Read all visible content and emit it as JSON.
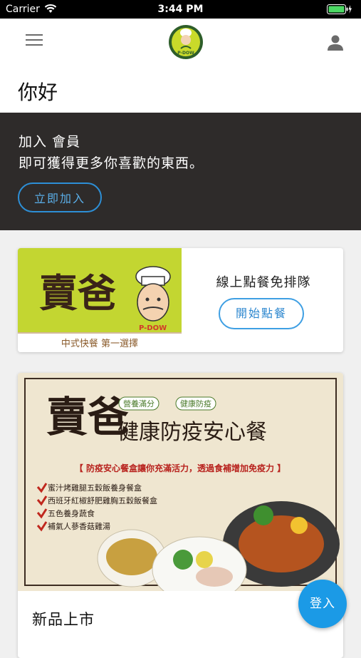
{
  "status_bar": {
    "carrier": "Carrier",
    "time": "3:44 PM"
  },
  "header": {
    "menu_icon": "hamburger-menu-icon",
    "logo_text": "P-DOW",
    "user_icon": "user-icon"
  },
  "greeting": "你好",
  "join_banner": {
    "line1": "加入 會員",
    "line2": "即可獲得更多你喜歡的東西。",
    "button_label": "立即加入"
  },
  "order_card": {
    "image_brand": "賣爸",
    "image_tagline": "中式快餐 第一選擇",
    "title": "線上點餐免排隊",
    "button_label": "開始點餐"
  },
  "news_card": {
    "image_brand": "賣爸",
    "image_badges": [
      "營養滿分",
      "健康防疫"
    ],
    "image_headline": "健康防疫安心餐",
    "image_subheading": "【 防疫安心餐盒讓你充滿活力，透過食補增加免疫力 】",
    "image_items": [
      "蜜汁烤雞腿五穀飯養身餐盒",
      "西班牙紅椒舒肥雞胸五穀飯餐盒",
      "五色養身蔬食",
      "補氣人蔘香菇雞湯"
    ],
    "title": "新品上市"
  },
  "login_button": "登入",
  "colors": {
    "accent": "#1b9ae6",
    "banner_bg": "#2e2b2a",
    "logo_bg": "#c9da2a"
  }
}
